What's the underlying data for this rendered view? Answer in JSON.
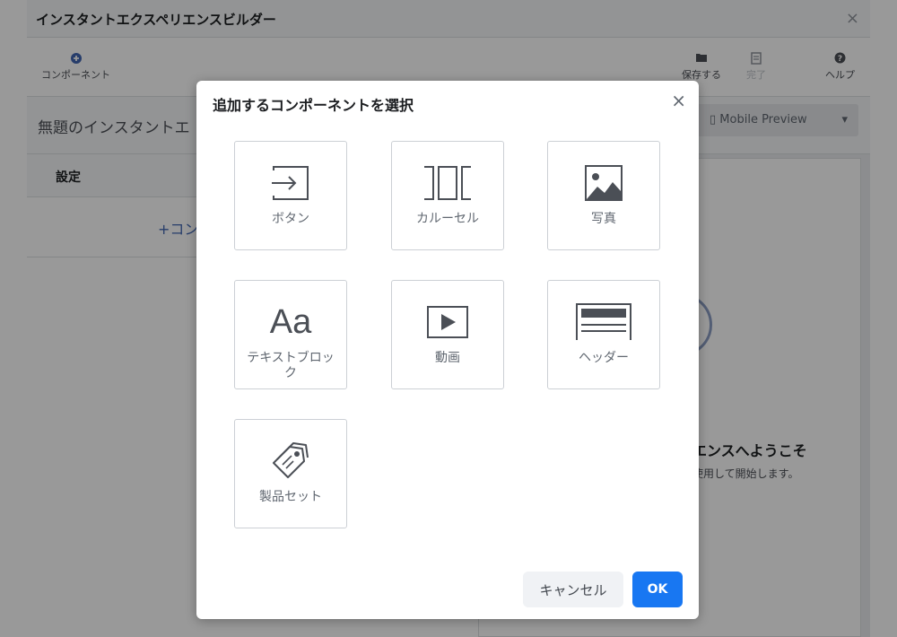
{
  "window": {
    "title": "インスタントエクスペリエンスビルダー",
    "close": "×"
  },
  "toolbar": {
    "component_label": "コンポーネント",
    "save_label": "保存する",
    "done_label": "完了",
    "help_label": "ヘルプ"
  },
  "editor": {
    "doc_title": "無題のインスタントエ",
    "preview_mode": "Mobile Preview",
    "settings_tab": "設定",
    "add_component": "+コン"
  },
  "preview": {
    "welcome_title": "エンスへようこそ",
    "welcome_sub": "使用して開始します。"
  },
  "dialog": {
    "title": "追加するコンポーネントを選択",
    "close": "×",
    "components": [
      {
        "label": "ボタン",
        "icon": "button-icon"
      },
      {
        "label": "カルーセル",
        "icon": "carousel-icon"
      },
      {
        "label": "写真",
        "icon": "photo-icon"
      },
      {
        "label": "テキストブロック",
        "glyph": "Aa",
        "icon": "text-block-icon"
      },
      {
        "label": "動画",
        "icon": "video-icon"
      },
      {
        "label": "ヘッダー",
        "icon": "header-icon"
      },
      {
        "label": "製品セット",
        "icon": "product-set-icon"
      }
    ],
    "cancel_label": "キャンセル",
    "ok_label": "OK"
  },
  "colors": {
    "primary": "#1877f2",
    "overlay": "rgba(0,0,0,0.4)",
    "icon": "#4b4f56"
  }
}
